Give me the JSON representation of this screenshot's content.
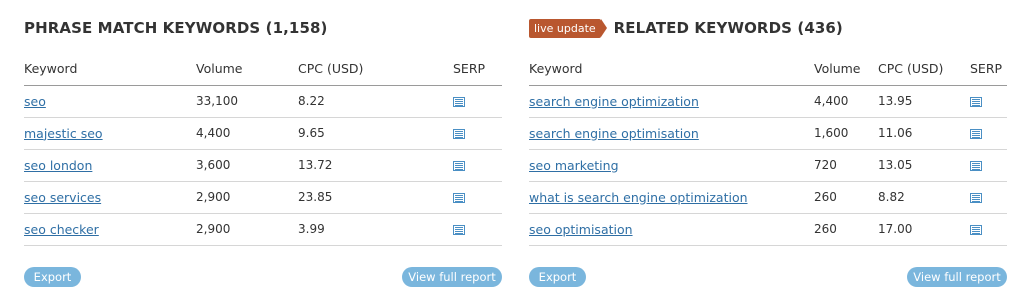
{
  "left_panel": {
    "title": "PHRASE MATCH KEYWORDS (1,158)",
    "columns": [
      "Keyword",
      "Volume",
      "CPC (USD)",
      "SERP"
    ],
    "rows": [
      {
        "keyword": "seo",
        "volume": "33,100",
        "cpc": "8.22"
      },
      {
        "keyword": "majestic seo",
        "volume": "4,400",
        "cpc": "9.65"
      },
      {
        "keyword": "seo london",
        "volume": "3,600",
        "cpc": "13.72"
      },
      {
        "keyword": "seo services",
        "volume": "2,900",
        "cpc": "23.85"
      },
      {
        "keyword": "seo checker",
        "volume": "2,900",
        "cpc": "3.99"
      }
    ],
    "export_label": "Export",
    "full_report_label": "View full report"
  },
  "right_panel": {
    "badge": "live update",
    "title": "RELATED KEYWORDS (436)",
    "columns": [
      "Keyword",
      "Volume",
      "CPC (USD)",
      "SERP"
    ],
    "rows": [
      {
        "keyword": "search engine optimization",
        "volume": "4,400",
        "cpc": "13.95"
      },
      {
        "keyword": "search engine optimisation",
        "volume": "1,600",
        "cpc": "11.06"
      },
      {
        "keyword": "seo marketing",
        "volume": "720",
        "cpc": "13.05"
      },
      {
        "keyword": "what is search engine optimization",
        "volume": "260",
        "cpc": "8.82"
      },
      {
        "keyword": "seo optimisation",
        "volume": "260",
        "cpc": "17.00"
      }
    ],
    "export_label": "Export",
    "full_report_label": "View full report"
  },
  "icons": {
    "serp": "serp-list-icon"
  },
  "colors": {
    "link": "#2f6fa5",
    "button": "#7ab6dd",
    "badge": "#b9572f",
    "serp_icon": "#4a8fc4"
  }
}
